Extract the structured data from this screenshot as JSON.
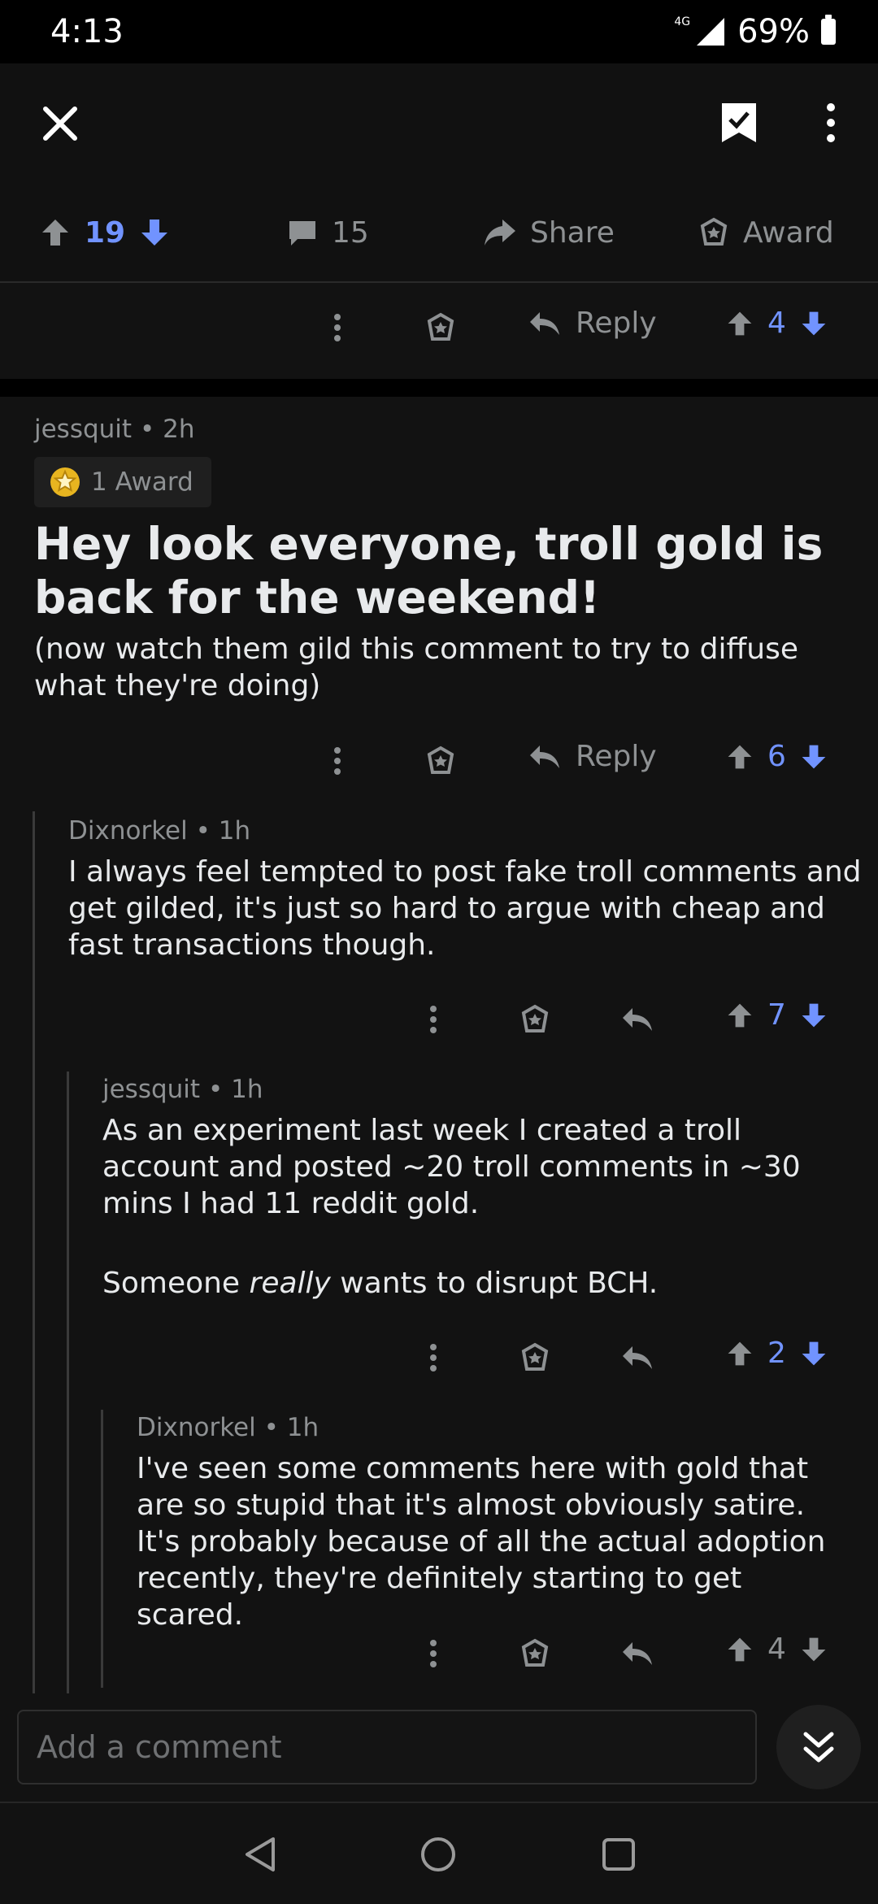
{
  "status_bar": {
    "time": "4:13",
    "network": "4G",
    "battery": "69%"
  },
  "post_actions": {
    "upvotes": "19",
    "comments": "15",
    "share_label": "Share",
    "award_label": "Award"
  },
  "prev_comment_actions": {
    "reply_label": "Reply",
    "score": "4"
  },
  "main_comment": {
    "author": "jessquit",
    "age": "2h",
    "award_label": "1 Award",
    "heading": "Hey look everyone, troll gold is back for the weekend!",
    "body": "(now watch them gild this comment to try to diffuse what they're doing)",
    "reply_label": "Reply",
    "score": "6"
  },
  "replies": [
    {
      "author": "Dixnorkel",
      "age": "1h",
      "body": "I always feel tempted to post fake troll comments and get gilded, it's just so hard to argue with cheap and fast transactions though.",
      "score": "7"
    },
    {
      "author": "jessquit",
      "age": "1h",
      "body_p1": "As an experiment last week I created a troll account and posted ~20 troll comments in ~30 mins I had 11 reddit gold.",
      "body_p2_pre": "Someone ",
      "body_p2_em": "really",
      "body_p2_post": " wants to disrupt BCH.",
      "score": "2"
    },
    {
      "author": "Dixnorkel",
      "age": "1h",
      "body": "I've seen some comments here with gold that are so stupid that it's almost obviously satire. It's probably because of all the actual adoption recently, they're definitely starting to get scared.",
      "score": "4"
    }
  ],
  "comment_input": {
    "placeholder": "Add a comment"
  },
  "colors": {
    "accent_blue": "#7193ff",
    "background": "#121212",
    "muted": "#8e9193"
  }
}
